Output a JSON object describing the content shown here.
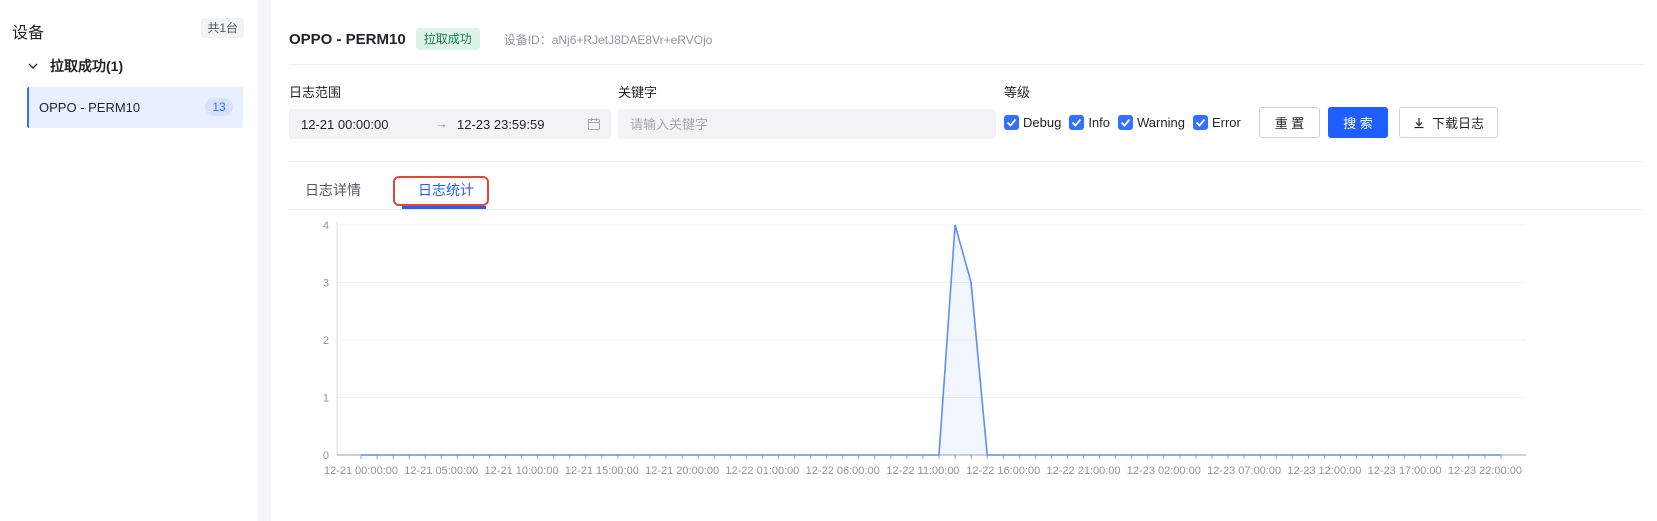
{
  "sidebar": {
    "title": "设备",
    "count_badge": "共1台",
    "group_label": "拉取成功(1)",
    "devices": [
      {
        "name": "OPPO - PERM10",
        "count": "13"
      }
    ]
  },
  "header": {
    "device_title": "OPPO - PERM10",
    "status_tag": "拉取成功",
    "device_id": "设备ID：aNj6+RJetJ8DAE8Vr+eRVOjo"
  },
  "filters": {
    "range_label": "日志范围",
    "range_start": "12-21 00:00:00",
    "range_end": "12-23 23:59:59",
    "keyword_label": "关键字",
    "keyword_placeholder": "请输入关键字",
    "keyword_value": "",
    "level_label": "等级",
    "levels": [
      {
        "label": "Debug",
        "checked": true
      },
      {
        "label": "Info",
        "checked": true
      },
      {
        "label": "Warning",
        "checked": true
      },
      {
        "label": "Error",
        "checked": true
      }
    ],
    "reset_label": "重 置",
    "search_label": "搜 索",
    "download_label": "下载日志"
  },
  "tabs": [
    {
      "label": "日志详情",
      "active": false
    },
    {
      "label": "日志统计",
      "active": true
    }
  ],
  "colors": {
    "accent": "#1f5fff",
    "line": "#5b8ff9",
    "highlight": "#e0473a",
    "success_bg": "#ddf3e6"
  },
  "chart_data": {
    "type": "area",
    "title": "",
    "xlabel": "",
    "ylabel": "",
    "ylim": [
      0,
      4
    ],
    "yticks": [
      0,
      1,
      2,
      3,
      4
    ],
    "grid": true,
    "x_start": "12-21 00:00:00",
    "x_interval_hours": 1,
    "x_tick_labels": [
      "12-21 00:00:00",
      "12-21 05:00:00",
      "12-21 10:00:00",
      "12-21 15:00:00",
      "12-21 20:00:00",
      "12-22 01:00:00",
      "12-22 06:00:00",
      "12-22 11:00:00",
      "12-22 16:00:00",
      "12-22 21:00:00",
      "12-23 02:00:00",
      "12-23 07:00:00",
      "12-23 12:00:00",
      "12-23 17:00:00",
      "12-23 22:00:00"
    ],
    "series": [
      {
        "values": [
          0,
          0,
          0,
          0,
          0,
          0,
          0,
          0,
          0,
          0,
          0,
          0,
          0,
          0,
          0,
          0,
          0,
          0,
          0,
          0,
          0,
          0,
          0,
          0,
          0,
          0,
          0,
          0,
          0,
          0,
          0,
          0,
          0,
          0,
          0,
          0,
          0,
          4,
          3,
          0,
          0,
          0,
          0,
          0,
          0,
          0,
          0,
          0,
          0,
          0,
          0,
          0,
          0,
          0,
          0,
          0,
          0,
          0,
          0,
          0,
          0,
          0,
          0,
          0,
          0,
          0,
          0,
          0,
          0,
          0,
          0,
          0
        ]
      }
    ]
  }
}
